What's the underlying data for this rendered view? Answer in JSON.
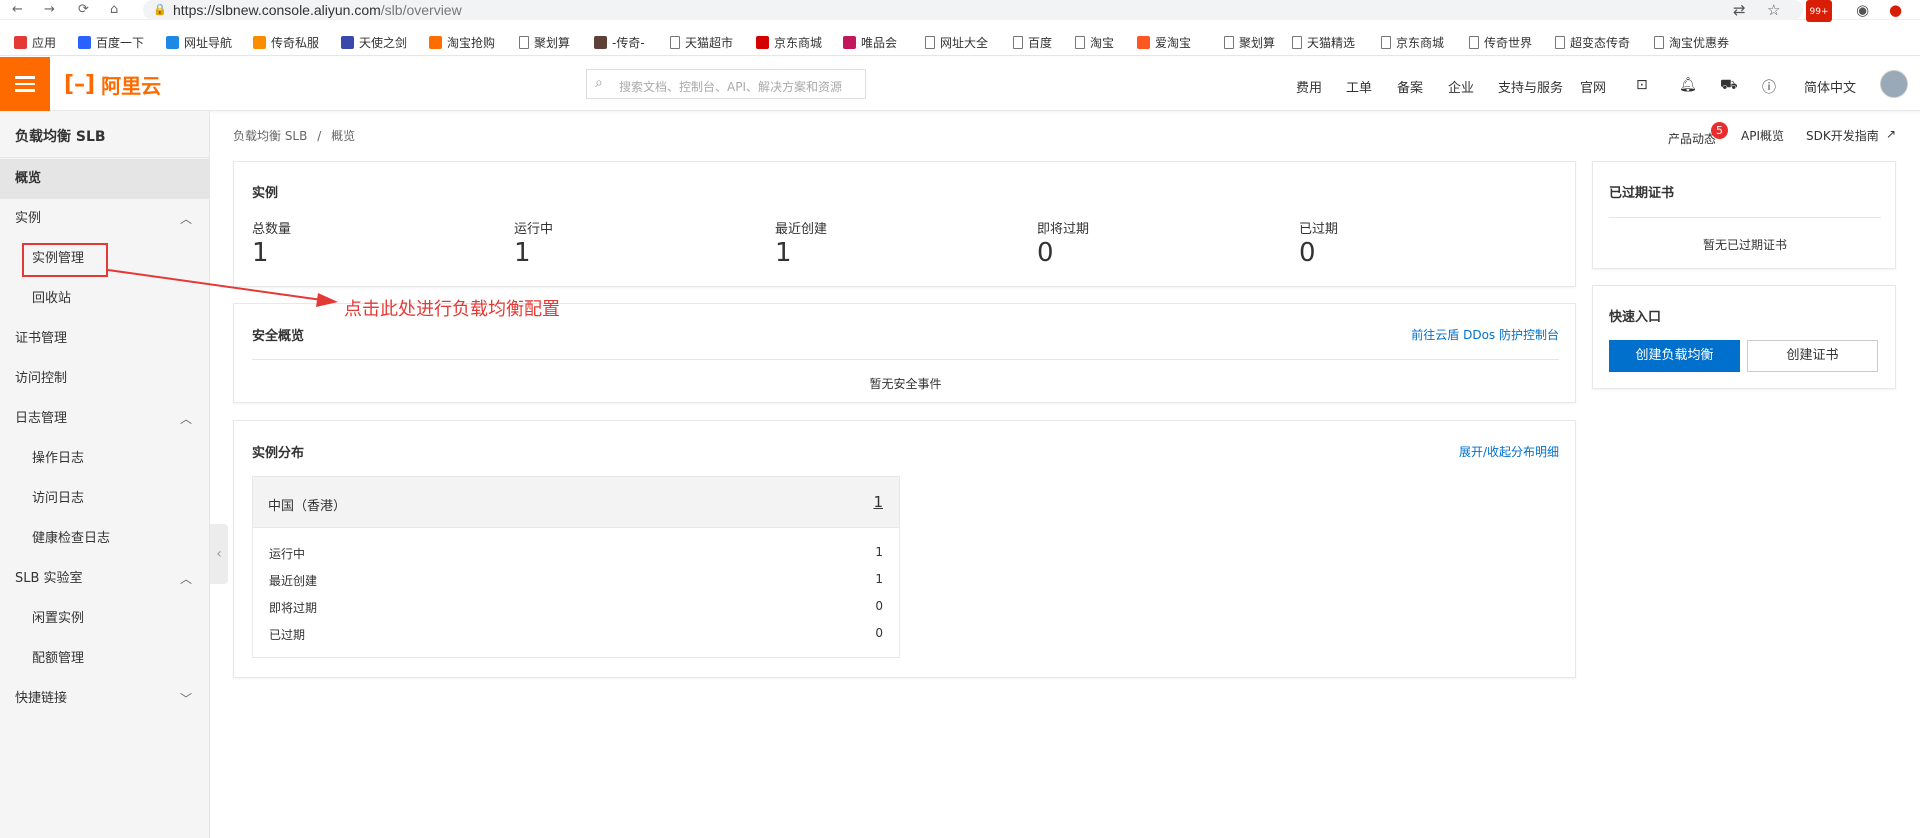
{
  "browser": {
    "url_host": "https://slbnew.console.aliyun.com",
    "url_path": "/slb/overview",
    "ext_badge": "99+"
  },
  "bookmarks": [
    {
      "label": "应用",
      "icon": "apps-grid-icon"
    },
    {
      "label": "百度一下",
      "icon": "baidu-icon"
    },
    {
      "label": "网址导航",
      "icon": "e-icon"
    },
    {
      "label": "传奇私服",
      "icon": "fire-icon"
    },
    {
      "label": "天使之剑",
      "icon": "angel-icon"
    },
    {
      "label": "淘宝抢购",
      "icon": "taobao-icon"
    },
    {
      "label": "聚划算",
      "icon": "doc-icon"
    },
    {
      "label": "-传奇-",
      "icon": "legend-icon"
    },
    {
      "label": "天猫超市",
      "icon": "doc-icon"
    },
    {
      "label": "京东商城",
      "icon": "jd-icon"
    },
    {
      "label": "唯品会",
      "icon": "vip-icon"
    },
    {
      "label": "网址大全",
      "icon": "doc-icon"
    },
    {
      "label": "百度",
      "icon": "doc-icon"
    },
    {
      "label": "淘宝",
      "icon": "doc-icon"
    },
    {
      "label": "爱淘宝",
      "icon": "aitaobao-icon"
    },
    {
      "label": "聚划算",
      "icon": "doc-icon"
    },
    {
      "label": "天猫精选",
      "icon": "doc-icon"
    },
    {
      "label": "京东商城",
      "icon": "doc-icon"
    },
    {
      "label": "传奇世界",
      "icon": "doc-icon"
    },
    {
      "label": "超变态传奇",
      "icon": "doc-icon"
    },
    {
      "label": "淘宝优惠券",
      "icon": "doc-icon"
    }
  ],
  "topbar": {
    "logo_text": "阿里云",
    "search_placeholder": "搜索文档、控制台、API、解决方案和资源",
    "nav": [
      "费用",
      "工单",
      "备案",
      "企业",
      "支持与服务",
      "官网"
    ],
    "language": "简体中文"
  },
  "sidebar": {
    "title": "负载均衡 SLB",
    "items": [
      {
        "label": "概览",
        "level": 0,
        "active": true
      },
      {
        "label": "实例",
        "level": 0,
        "expandable": true
      },
      {
        "label": "实例管理",
        "level": 1
      },
      {
        "label": "回收站",
        "level": 1
      },
      {
        "label": "证书管理",
        "level": 0
      },
      {
        "label": "访问控制",
        "level": 0
      },
      {
        "label": "日志管理",
        "level": 0,
        "expandable": true
      },
      {
        "label": "操作日志",
        "level": 1
      },
      {
        "label": "访问日志",
        "level": 1
      },
      {
        "label": "健康检查日志",
        "level": 1
      },
      {
        "label": "SLB 实验室",
        "level": 0,
        "expandable": true
      },
      {
        "label": "闲置实例",
        "level": 1
      },
      {
        "label": "配额管理",
        "level": 1
      },
      {
        "label": "快捷链接",
        "level": 0,
        "expandable": true
      }
    ]
  },
  "breadcrumb": {
    "root": "负载均衡 SLB",
    "sep": "/",
    "current": "概览"
  },
  "header_links": {
    "product_news": "产品动态",
    "product_news_badge": "5",
    "api": "API概览",
    "sdk": "SDK开发指南"
  },
  "instances": {
    "title": "实例",
    "stats": [
      {
        "label": "总数量",
        "value": "1"
      },
      {
        "label": "运行中",
        "value": "1"
      },
      {
        "label": "最近创建",
        "value": "1"
      },
      {
        "label": "即将过期",
        "value": "0"
      },
      {
        "label": "已过期",
        "value": "0"
      }
    ]
  },
  "security": {
    "title": "安全概览",
    "link": "前往云盾 DDos 防护控制台",
    "empty": "暂无安全事件"
  },
  "distribution": {
    "title": "实例分布",
    "toggle": "展开/收起分布明细",
    "region": "中国（香港）",
    "region_count": "1",
    "rows": [
      {
        "label": "运行中",
        "value": "1"
      },
      {
        "label": "最近创建",
        "value": "1"
      },
      {
        "label": "即将过期",
        "value": "0"
      },
      {
        "label": "已过期",
        "value": "0"
      }
    ]
  },
  "expired_certs": {
    "title": "已过期证书",
    "empty": "暂无已过期证书"
  },
  "quick_entry": {
    "title": "快速入口",
    "primary": "创建负载均衡",
    "secondary": "创建证书"
  },
  "annotation": {
    "text": "点击此处进行负载均衡配置",
    "color": "#e53935"
  },
  "colors": {
    "brand": "#ff6a00",
    "primary": "#0070cc",
    "alert": "#e62e2e"
  }
}
